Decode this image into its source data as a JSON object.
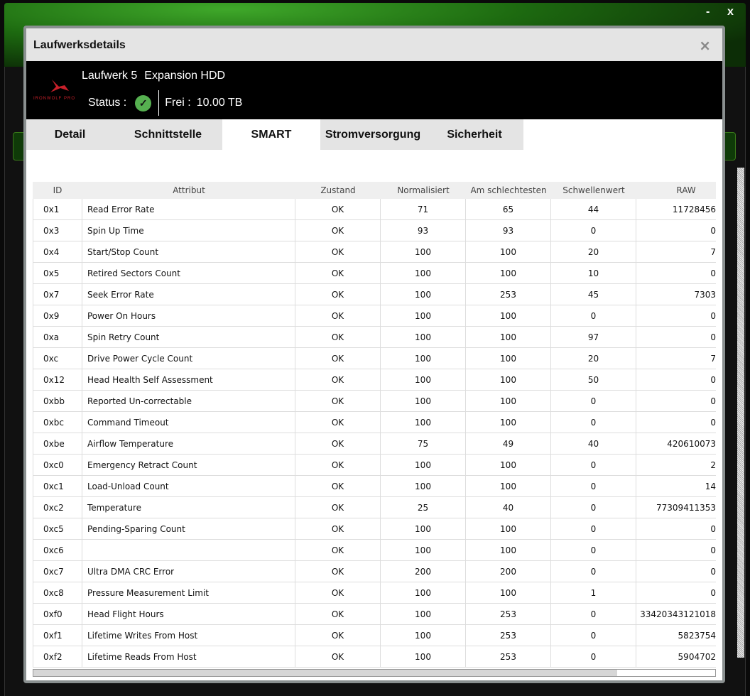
{
  "window_controls": {
    "minimize": "-",
    "close": "x"
  },
  "dialog": {
    "title": "Laufwerksdetails",
    "close": "×"
  },
  "header": {
    "logo_text": "IRONWOLF PRO",
    "drive_label": "Laufwerk 5",
    "drive_name": "Expansion HDD",
    "status_label": "Status :",
    "status": "ok",
    "free_label": "Frei :",
    "free_value": "10.00 TB",
    "accent": "#56b050"
  },
  "tabs": [
    {
      "label": "Detail"
    },
    {
      "label": "Schnittstelle"
    },
    {
      "label": "SMART",
      "active": true
    },
    {
      "label": "Stromversorgung"
    },
    {
      "label": "Sicherheit"
    }
  ],
  "table": {
    "columns": [
      "ID",
      "Attribut",
      "Zustand",
      "Normalisiert",
      "Am schlechtesten",
      "Schwellenwert",
      "RAW"
    ],
    "rows": [
      [
        "0x1",
        "Read Error Rate",
        "OK",
        "71",
        "65",
        "44",
        "11728456"
      ],
      [
        "0x3",
        "Spin Up Time",
        "OK",
        "93",
        "93",
        "0",
        "0"
      ],
      [
        "0x4",
        "Start/Stop Count",
        "OK",
        "100",
        "100",
        "20",
        "7"
      ],
      [
        "0x5",
        "Retired Sectors Count",
        "OK",
        "100",
        "100",
        "10",
        "0"
      ],
      [
        "0x7",
        "Seek Error Rate",
        "OK",
        "100",
        "253",
        "45",
        "7303"
      ],
      [
        "0x9",
        "Power On Hours",
        "OK",
        "100",
        "100",
        "0",
        "0"
      ],
      [
        "0xa",
        "Spin Retry Count",
        "OK",
        "100",
        "100",
        "97",
        "0"
      ],
      [
        "0xc",
        "Drive Power Cycle Count",
        "OK",
        "100",
        "100",
        "20",
        "7"
      ],
      [
        "0x12",
        "Head Health Self Assessment",
        "OK",
        "100",
        "100",
        "50",
        "0"
      ],
      [
        "0xbb",
        "Reported Un-correctable",
        "OK",
        "100",
        "100",
        "0",
        "0"
      ],
      [
        "0xbc",
        "Command Timeout",
        "OK",
        "100",
        "100",
        "0",
        "0"
      ],
      [
        "0xbe",
        "Airflow Temperature",
        "OK",
        "75",
        "49",
        "40",
        "420610073"
      ],
      [
        "0xc0",
        "Emergency Retract Count",
        "OK",
        "100",
        "100",
        "0",
        "2"
      ],
      [
        "0xc1",
        "Load-Unload Count",
        "OK",
        "100",
        "100",
        "0",
        "14"
      ],
      [
        "0xc2",
        "Temperature",
        "OK",
        "25",
        "40",
        "0",
        "77309411353"
      ],
      [
        "0xc5",
        "Pending-Sparing Count",
        "OK",
        "100",
        "100",
        "0",
        "0"
      ],
      [
        "0xc6",
        "",
        "OK",
        "100",
        "100",
        "0",
        "0"
      ],
      [
        "0xc7",
        "Ultra DMA CRC Error",
        "OK",
        "200",
        "200",
        "0",
        "0"
      ],
      [
        "0xc8",
        "Pressure Measurement Limit",
        "OK",
        "100",
        "100",
        "1",
        "0"
      ],
      [
        "0xf0",
        "Head Flight Hours",
        "OK",
        "100",
        "253",
        "0",
        "33420343121018"
      ],
      [
        "0xf1",
        "Lifetime Writes From Host",
        "OK",
        "100",
        "253",
        "0",
        "5823754"
      ],
      [
        "0xf2",
        "Lifetime Reads From Host",
        "OK",
        "100",
        "253",
        "0",
        "5904702"
      ]
    ]
  }
}
